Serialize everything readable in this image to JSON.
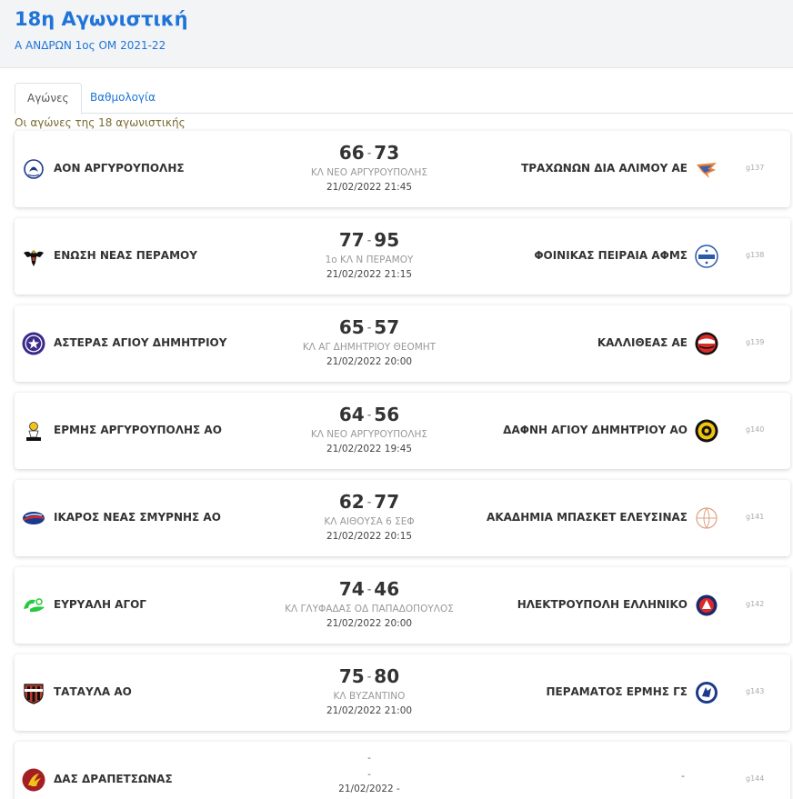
{
  "header": {
    "title": "18η Αγωνιστική",
    "subtitle": "Α ΑΝΔΡΩΝ 1ος ΟΜ 2021-22"
  },
  "tabs": [
    {
      "label": "Αγώνες"
    },
    {
      "label": "Βαθμολογία"
    }
  ],
  "intro": "Οι αγώνες της 18 αγωνιστικής",
  "colors": {
    "accent": "#1e74d8"
  },
  "matches": [
    {
      "home": "ΑΟΝ ΑΡΓΥΡΟΥΠΟΛΗΣ",
      "home_score": "66",
      "sep": "-",
      "away_score": "73",
      "away": "ΤΡΑΧΩΝΩΝ ΔΙΑ ΑΛΙΜΟΥ ΑΕ",
      "venue": "ΚΛ ΝΕΟ ΑΡΓΥΡΟΥΠΟΛΗΣ",
      "date": "21/02/2022 21:45",
      "game_id": "g137",
      "home_logo": "aon-crest-icon",
      "away_logo": "trachones-bird-icon"
    },
    {
      "home": "ΕΝΩΣΗ ΝΕΑΣ ΠΕΡΑΜΟΥ",
      "home_score": "77",
      "sep": "-",
      "away_score": "95",
      "away": "ΦΟΙΝΙΚΑΣ ΠΕΙΡΑΙΑ ΑΦΜΣ",
      "venue": "1ο ΚΛ Ν ΠΕΡΑΜΟΥ",
      "date": "21/02/2022 21:15",
      "game_id": "g138",
      "home_logo": "eagle-crest-icon",
      "away_logo": "foinikas-1949-icon"
    },
    {
      "home": "ΑΣΤΕΡΑΣ ΑΓΙΟΥ ΔΗΜΗΤΡΙΟΥ",
      "home_score": "65",
      "sep": "-",
      "away_score": "57",
      "away": "ΚΑΛΛΙΘΕΑΣ ΑΕ",
      "venue": "ΚΛ ΑΓ ΔΗΜΗΤΡΙΟΥ ΘΕΟΜΗΤ",
      "date": "21/02/2022 20:00",
      "game_id": "g139",
      "home_logo": "star-crest-icon",
      "away_logo": "kallithea-crest-icon"
    },
    {
      "home": "ΕΡΜΗΣ ΑΡΓΥΡΟΥΠΟΛΗΣ ΑΟ",
      "home_score": "64",
      "sep": "-",
      "away_score": "56",
      "away": "ΔΑΦΝΗ ΑΓΙΟΥ ΔΗΜΗΤΡΙΟΥ ΑΟ",
      "venue": "ΚΛ ΝΕΟ ΑΡΓΥΡΟΥΠΟΛΗΣ",
      "date": "21/02/2022 19:45",
      "game_id": "g140",
      "home_logo": "ermis-crest-icon",
      "away_logo": "dafni-crest-icon"
    },
    {
      "home": "ΙΚΑΡΟΣ ΝΕΑΣ ΣΜΥΡΝΗΣ ΑΟ",
      "home_score": "62",
      "sep": "-",
      "away_score": "77",
      "away": "ΑΚΑΔΗΜΙΑ ΜΠΑΣΚΕΤ ΕΛΕΥΣΙΝΑΣ",
      "venue": "ΚΛ ΑΙΘΟΥΣΑ 6 ΣΕΦ",
      "date": "21/02/2022 20:15",
      "game_id": "g141",
      "home_logo": "ikaros-crest-icon",
      "away_logo": "basketball-outline-icon"
    },
    {
      "home": "ΕΥΡΥΑΛΗ ΑΓΟΓ",
      "home_score": "74",
      "sep": "-",
      "away_score": "46",
      "away": "ΗΛΕΚΤΡΟΥΠΟΛΗ ΕΛΛΗΝΙΚΟ",
      "venue": "ΚΛ ΓΛΥΦΑΔΑΣ ΟΔ ΠΑΠΑΔΟΠΟΥΛΟΣ",
      "date": "21/02/2022 20:00",
      "game_id": "g142",
      "home_logo": "evryali-green-icon",
      "away_logo": "ilektroupoli-crest-icon"
    },
    {
      "home": "ΤΑΤΑΥΛΑ ΑΟ",
      "home_score": "75",
      "sep": "-",
      "away_score": "80",
      "away": "ΠΕΡΑΜΑΤΟΣ ΕΡΜΗΣ ΓΣ",
      "venue": "ΚΛ ΒΥΖΑΝΤΙΝΟ",
      "date": "21/02/2022 21:00",
      "game_id": "g143",
      "home_logo": "tatavla-shield-icon",
      "away_logo": "peramatos-crest-icon"
    }
  ],
  "pending_match": {
    "home": "ΔΑΣ ΔΡΑΠΕΤΣΩΝΑΣ",
    "line1": "-",
    "line2": "-",
    "date": "21/02/2022 -",
    "away": "-",
    "game_id": "g144",
    "home_logo": "drapetsona-crest-icon"
  }
}
